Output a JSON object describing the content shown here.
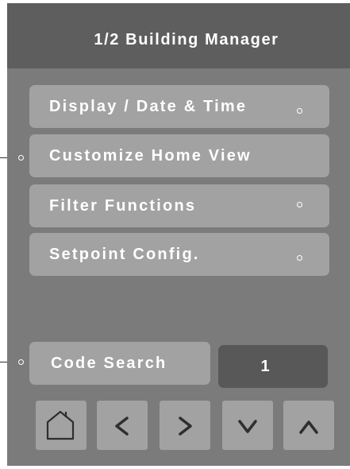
{
  "header": {
    "title": "1/2 Building Manager"
  },
  "menu": {
    "items": [
      {
        "label": "Display / Date & Time"
      },
      {
        "label": "Customize Home View"
      },
      {
        "label": "Filter Functions"
      },
      {
        "label": "Setpoint Config."
      }
    ]
  },
  "code_search": {
    "label": "Code Search",
    "value": "1"
  },
  "nav": {
    "buttons": [
      {
        "icon": "home-icon"
      },
      {
        "icon": "chevron-left-icon"
      },
      {
        "icon": "chevron-right-icon"
      },
      {
        "icon": "chevron-down-icon"
      },
      {
        "icon": "chevron-up-icon"
      }
    ]
  },
  "colors": {
    "screen_background": "#7b7b7b",
    "header_background": "#5e5e5e",
    "button_background": "#a2a2a2",
    "value_field_background": "#585858",
    "text": "#ffffff"
  }
}
